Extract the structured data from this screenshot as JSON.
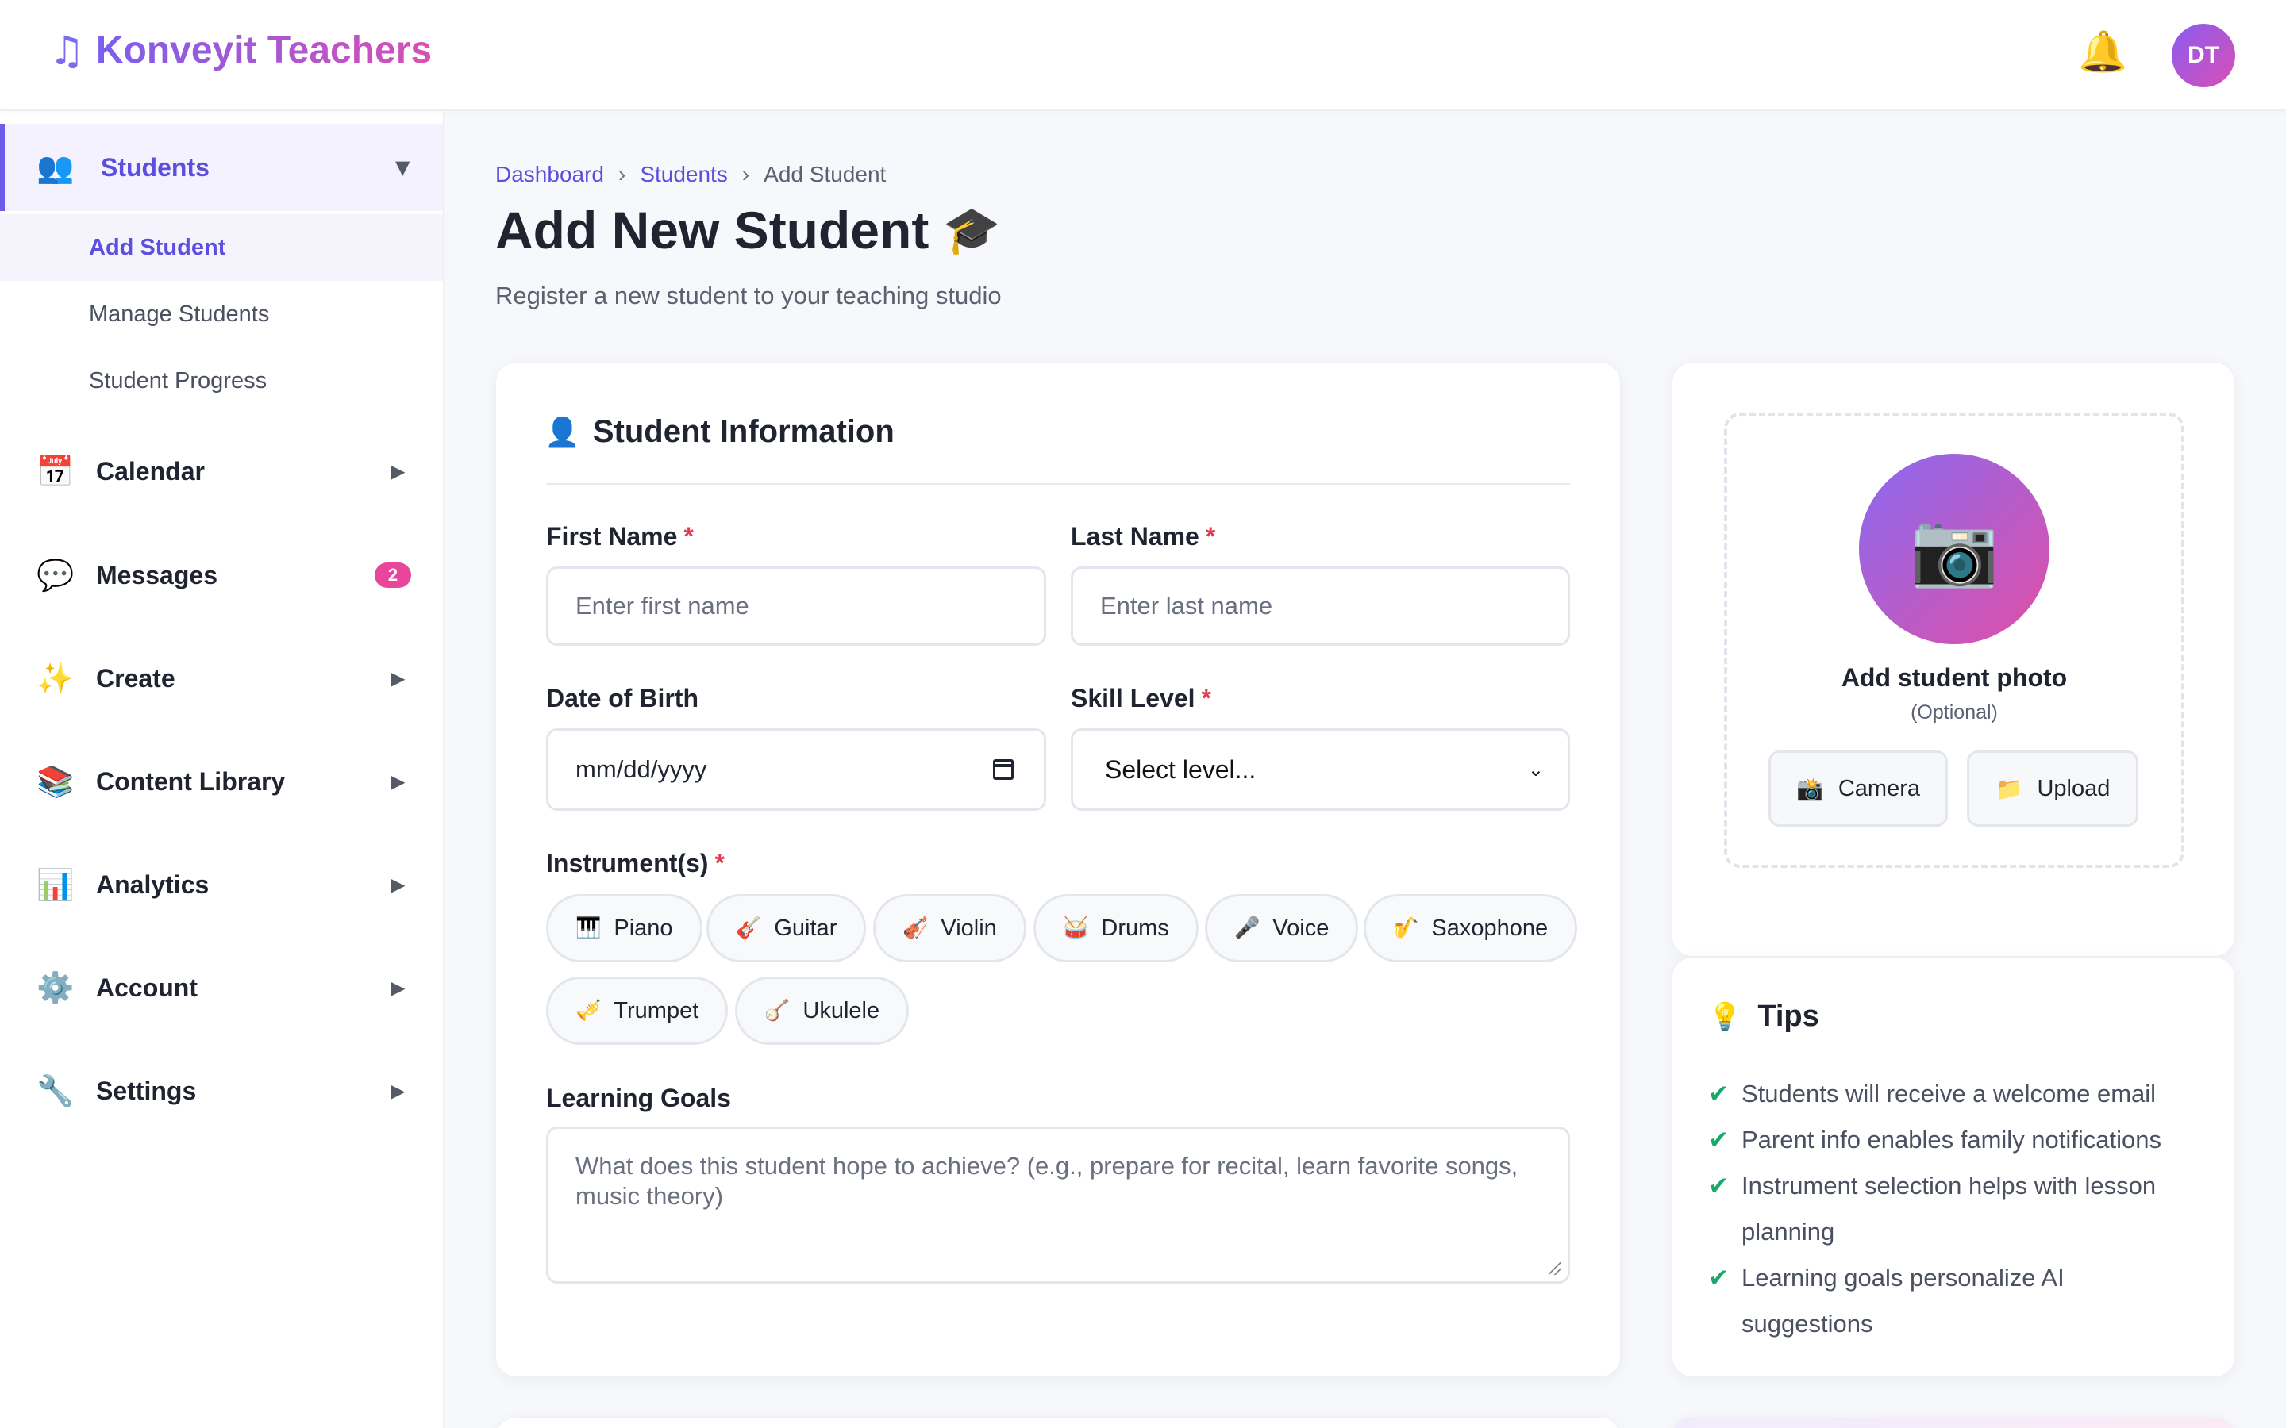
{
  "app": {
    "brand_icon": "♫",
    "brand": "Konveyit Teachers",
    "bell_icon": "🔔",
    "avatar_initials": "DT",
    "accent": "#5b4ee0",
    "gradient_start": "#7a5ff0",
    "gradient_end": "#d94fb5"
  },
  "sidebar": {
    "students": {
      "icon": "👥",
      "label": "Students",
      "arrow": "▼"
    },
    "students_sub": [
      {
        "label": "Add Student"
      },
      {
        "label": "Manage Students"
      },
      {
        "label": "Student Progress"
      }
    ],
    "items": [
      {
        "icon": "📅",
        "label": "Calendar",
        "arrow": "▶"
      },
      {
        "icon": "💬",
        "label": "Messages",
        "badge": "2"
      },
      {
        "icon": "✨",
        "label": "Create",
        "arrow": "▶"
      },
      {
        "icon": "📚",
        "label": "Content Library",
        "arrow": "▶"
      },
      {
        "icon": "📊",
        "label": "Analytics",
        "arrow": "▶"
      },
      {
        "icon": "⚙️",
        "label": "Account",
        "arrow": "▶"
      },
      {
        "icon": "🔧",
        "label": "Settings",
        "arrow": "▶"
      }
    ]
  },
  "breadcrumb": {
    "items": [
      "Dashboard",
      "Students",
      "Add Student"
    ],
    "separator": "›"
  },
  "page": {
    "title": "Add New Student",
    "title_icon": "🎓",
    "subtitle": "Register a new student to your teaching studio"
  },
  "form": {
    "section_icon": "👤",
    "section_title": "Student Information",
    "required_mark": "*",
    "first_name": {
      "label": "First Name",
      "placeholder": "Enter first name"
    },
    "last_name": {
      "label": "Last Name",
      "placeholder": "Enter last name"
    },
    "dob": {
      "label": "Date of Birth",
      "value": "mm/dd/yyyy"
    },
    "skill": {
      "label": "Skill Level",
      "value": "Select level...",
      "chevron": "⌄"
    },
    "instruments": {
      "label": "Instrument(s)",
      "options": [
        {
          "icon": "🎹",
          "label": "Piano"
        },
        {
          "icon": "🎸",
          "label": "Guitar"
        },
        {
          "icon": "🎻",
          "label": "Violin"
        },
        {
          "icon": "🥁",
          "label": "Drums"
        },
        {
          "icon": "🎤",
          "label": "Voice"
        },
        {
          "icon": "🎷",
          "label": "Saxophone"
        },
        {
          "icon": "🎺",
          "label": "Trumpet"
        },
        {
          "icon": "🪕",
          "label": "Ukulele"
        }
      ]
    },
    "goals": {
      "label": "Learning Goals",
      "placeholder": "What does this student hope to achieve? (e.g., prepare for recital, learn favorite songs, music theory)"
    }
  },
  "photo": {
    "icon": "📷",
    "title": "Add student photo",
    "optional": "(Optional)",
    "camera": {
      "icon": "📸",
      "label": "Camera"
    },
    "upload": {
      "icon": "📁",
      "label": "Upload"
    }
  },
  "tips": {
    "icon": "💡",
    "title": "Tips",
    "check": "✔",
    "items": [
      "Students will receive a welcome email",
      "Parent info enables family notifications",
      "Instrument selection helps with lesson planning",
      "Learning goals personalize AI suggestions"
    ]
  }
}
